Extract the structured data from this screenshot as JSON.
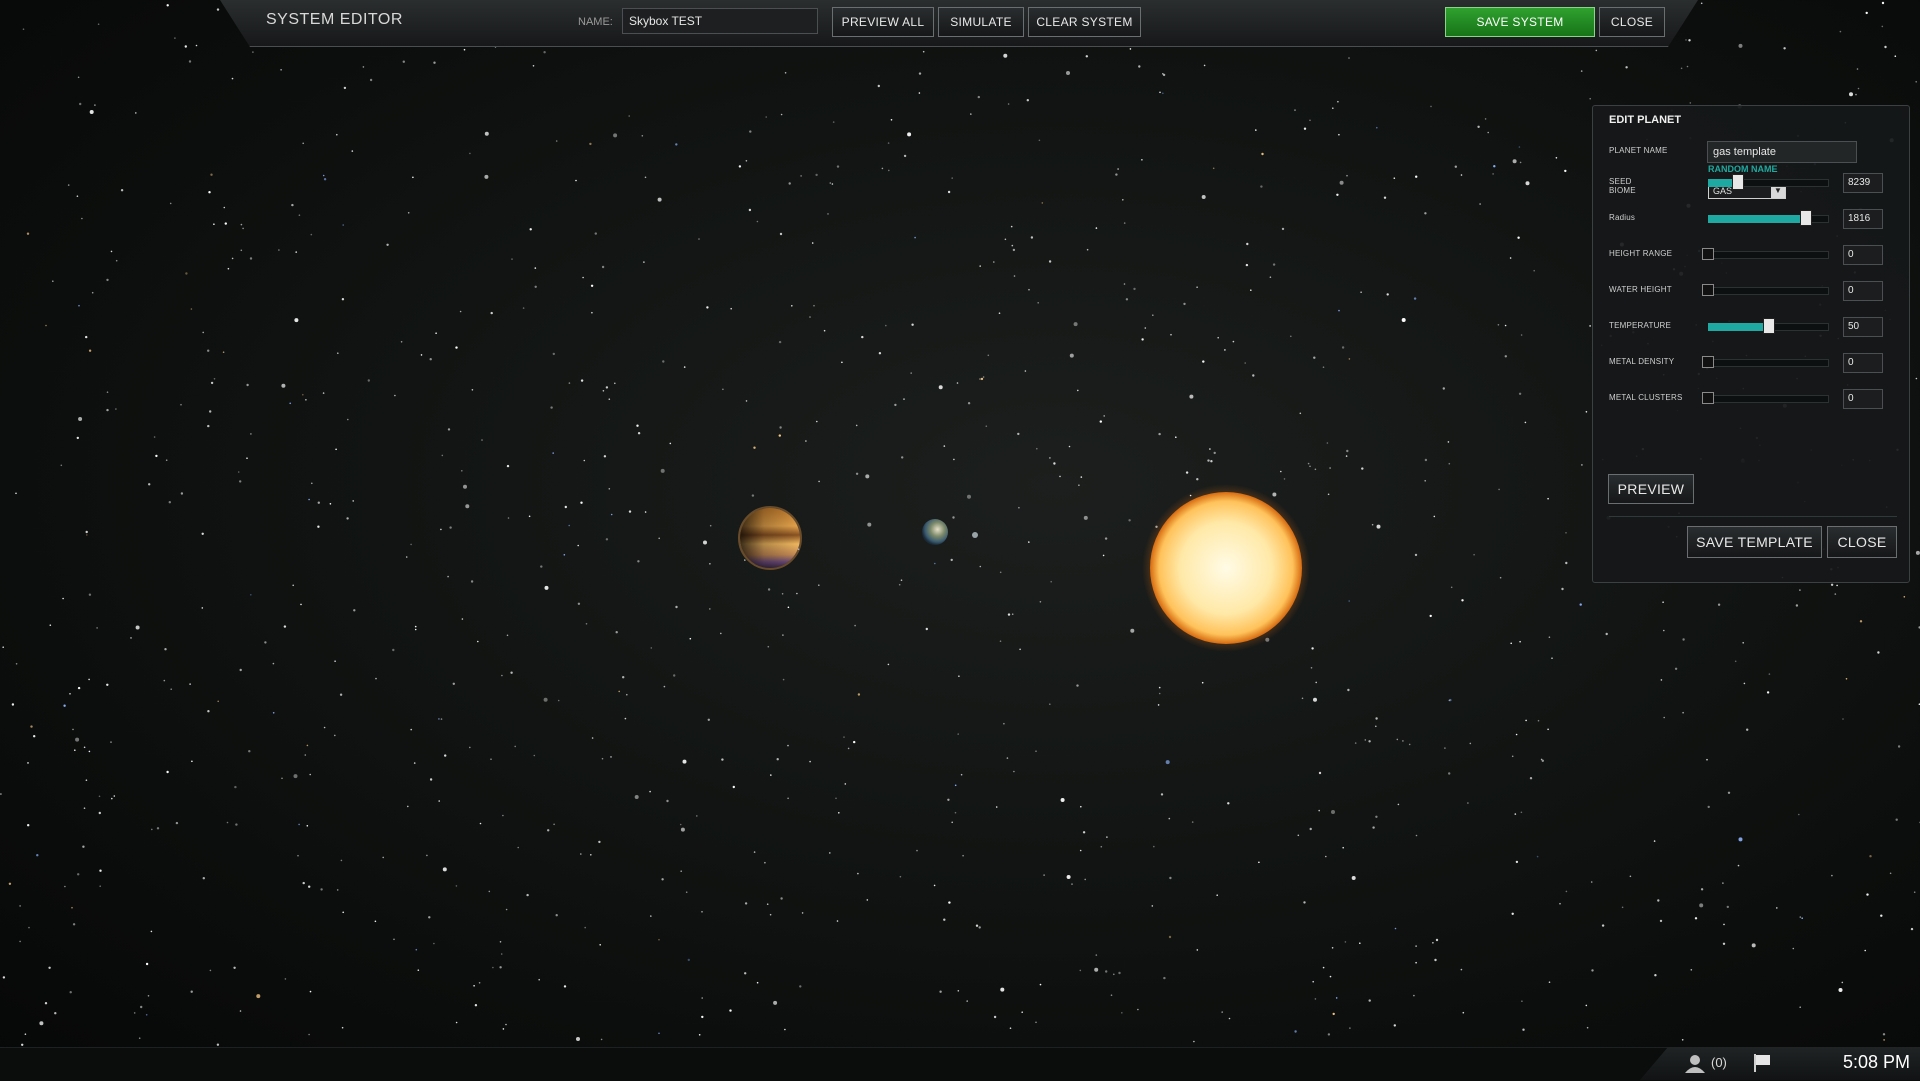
{
  "toolbar": {
    "title": "SYSTEM EDITOR",
    "name_label": "NAME:",
    "name_value": "Skybox TEST",
    "preview_all": "PREVIEW ALL",
    "simulate": "SIMULATE",
    "clear_system": "CLEAR SYSTEM",
    "save_system": "SAVE SYSTEM",
    "close": "CLOSE"
  },
  "edit_planet": {
    "title": "EDIT PLANET",
    "planet_name_label": "PLANET NAME",
    "planet_name_value": "gas template",
    "random_name": "RANDOM NAME",
    "biome_label": "BIOME",
    "biome_value": "GAS",
    "sliders": [
      {
        "label": "SEED",
        "value": "8239",
        "level": 0.25
      },
      {
        "label": "Radius",
        "value": "1816",
        "level": 0.81
      },
      {
        "label": "HEIGHT RANGE",
        "value": "0",
        "level": 0
      },
      {
        "label": "WATER HEIGHT",
        "value": "0",
        "level": 0
      },
      {
        "label": "TEMPERATURE",
        "value": "50",
        "level": 0.5
      },
      {
        "label": "METAL DENSITY",
        "value": "0",
        "level": 0
      },
      {
        "label": "METAL CLUSTERS",
        "value": "0",
        "level": 0
      }
    ],
    "preview": "PREVIEW",
    "save_template": "SAVE TEMPLATE",
    "close": "CLOSE"
  },
  "taskbar": {
    "notifications": "(0)",
    "time": "5:08 PM"
  },
  "colors": {
    "accent": "#1ea9a3",
    "save_green": "#259325",
    "sun": "#ffd27a"
  }
}
